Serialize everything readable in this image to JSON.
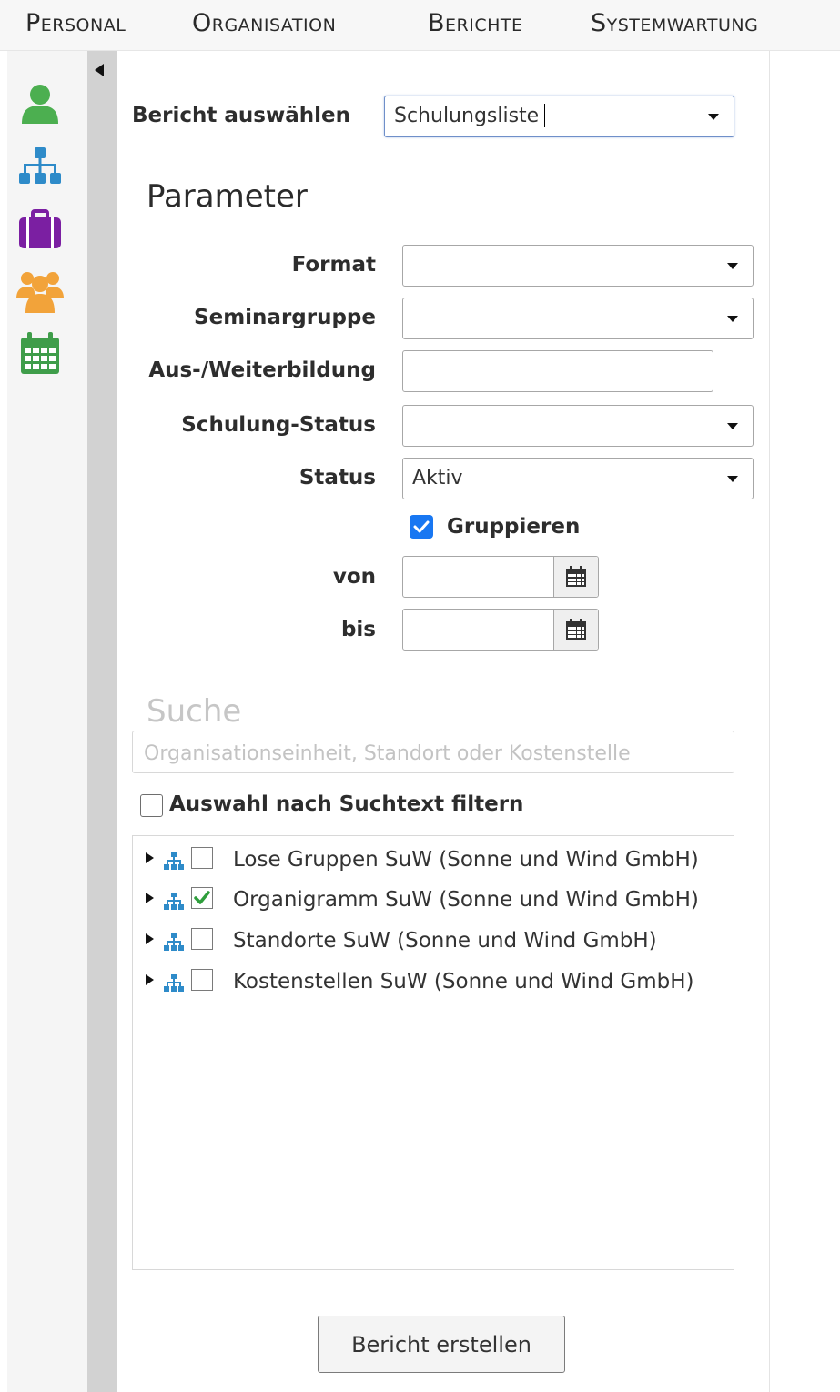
{
  "menu": {
    "items": [
      "Personal",
      "Organisation",
      "Berichte",
      "Systemwartung"
    ]
  },
  "sidebar": {
    "icons": [
      {
        "name": "person-icon",
        "color": "#4caf50"
      },
      {
        "name": "org-chart-icon",
        "color": "#2e8bc9"
      },
      {
        "name": "briefcase-icon",
        "color": "#7b1fa2"
      },
      {
        "name": "group-icon",
        "color": "#f2a33a"
      },
      {
        "name": "calendar-icon",
        "color": "#3f9d4a"
      }
    ]
  },
  "report": {
    "label": "Bericht auswählen",
    "selected": "Schulungsliste"
  },
  "parameters": {
    "heading": "Parameter",
    "format_label": "Format",
    "format_value": "",
    "seminargruppe_label": "Seminargruppe",
    "seminargruppe_value": "",
    "ausbildung_label": "Aus-/Weiterbildung",
    "ausbildung_value": "",
    "schulung_status_label": "Schulung-Status",
    "schulung_status_value": "",
    "status_label": "Status",
    "status_value": "Aktiv",
    "gruppieren_label": "Gruppieren",
    "gruppieren_checked": true,
    "von_label": "von",
    "von_value": "",
    "bis_label": "bis",
    "bis_value": ""
  },
  "search": {
    "heading": "Suche",
    "placeholder": "Organisationseinheit, Standort oder Kostenstelle",
    "filter_label": "Auswahl nach Suchtext filtern",
    "filter_checked": false
  },
  "tree": {
    "items": [
      {
        "label": "Lose Gruppen SuW (Sonne und Wind GmbH)",
        "checked": false
      },
      {
        "label": "Organigramm SuW (Sonne und Wind GmbH)",
        "checked": true
      },
      {
        "label": "Standorte SuW (Sonne und Wind GmbH)",
        "checked": false
      },
      {
        "label": "Kostenstellen SuW (Sonne und Wind GmbH)",
        "checked": false
      }
    ]
  },
  "actions": {
    "submit_label": "Bericht erstellen"
  },
  "colors": {
    "accent_blue": "#1877f2",
    "check_green": "#2e9e3c",
    "splitter": "#d2d2d2"
  }
}
